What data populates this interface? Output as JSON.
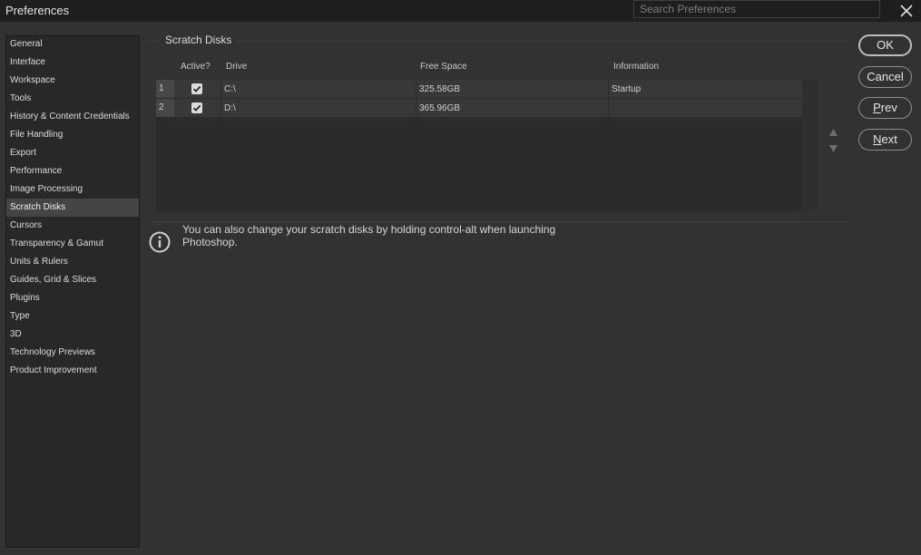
{
  "window": {
    "title": "Preferences",
    "search_placeholder": "Search Preferences"
  },
  "sidebar": {
    "items": [
      {
        "label": "General",
        "selected": false
      },
      {
        "label": "Interface",
        "selected": false
      },
      {
        "label": "Workspace",
        "selected": false
      },
      {
        "label": "Tools",
        "selected": false
      },
      {
        "label": "History & Content Credentials",
        "selected": false
      },
      {
        "label": "File Handling",
        "selected": false
      },
      {
        "label": "Export",
        "selected": false
      },
      {
        "label": "Performance",
        "selected": false
      },
      {
        "label": "Image Processing",
        "selected": false
      },
      {
        "label": "Scratch Disks",
        "selected": true
      },
      {
        "label": "Cursors",
        "selected": false
      },
      {
        "label": "Transparency & Gamut",
        "selected": false
      },
      {
        "label": "Units & Rulers",
        "selected": false
      },
      {
        "label": "Guides, Grid & Slices",
        "selected": false
      },
      {
        "label": "Plugins",
        "selected": false
      },
      {
        "label": "Type",
        "selected": false
      },
      {
        "label": "3D",
        "selected": false
      },
      {
        "label": "Technology Previews",
        "selected": false
      },
      {
        "label": "Product Improvement",
        "selected": false
      }
    ]
  },
  "section": {
    "title": "Scratch Disks",
    "columns": {
      "active": "Active?",
      "drive": "Drive",
      "free_space": "Free Space",
      "information": "Information"
    },
    "rows": [
      {
        "num": "1",
        "active": true,
        "drive": "C:\\",
        "free_space": "325.58GB",
        "information": "Startup"
      },
      {
        "num": "2",
        "active": true,
        "drive": "D:\\",
        "free_space": "365.96GB",
        "information": ""
      }
    ],
    "info_text": "You can also change your scratch disks by holding control-alt when launching Photoshop."
  },
  "buttons": {
    "ok": "OK",
    "cancel": "Cancel",
    "prev_mnemonic": "P",
    "prev_rest": "rev",
    "next_mnemonic": "N",
    "next_rest": "ext"
  },
  "icons": {
    "close": "close-icon",
    "checkbox": "checkmark-icon",
    "info": "info-icon",
    "move_up": "triangle-up-icon",
    "move_down": "triangle-down-icon"
  }
}
